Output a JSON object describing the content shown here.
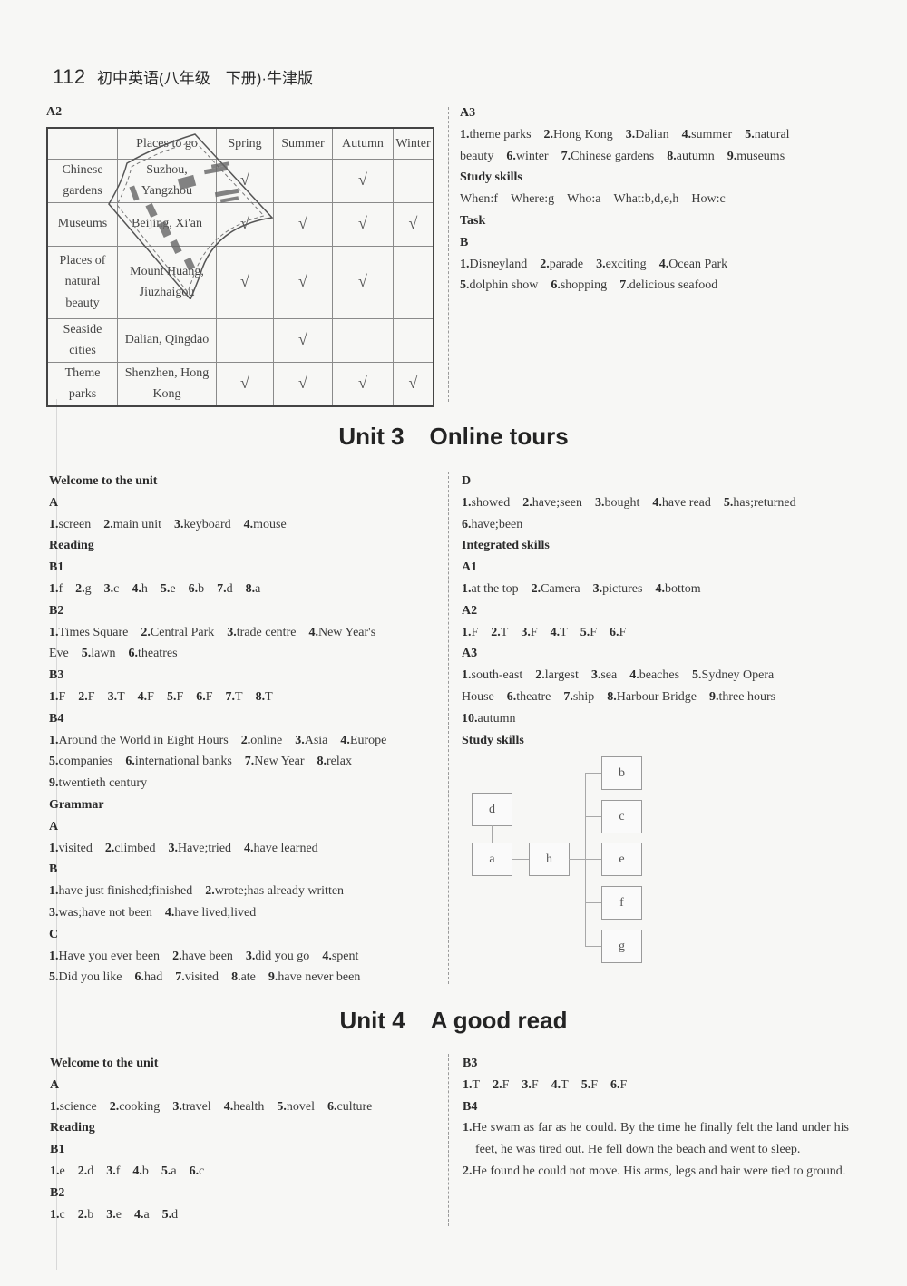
{
  "header": {
    "page_number": "112",
    "book_title": "初中英语(八年级　下册)·牛津版"
  },
  "unit2_tail": {
    "a2": {
      "label": "A2",
      "columns": [
        "",
        "Places to go",
        "Spring",
        "Summer",
        "Autumn",
        "Winter"
      ],
      "rows": [
        {
          "category": "Chinese gardens",
          "places": "Suzhou, Yangzhou",
          "spring": "√",
          "summer": "",
          "autumn": "√",
          "winter": ""
        },
        {
          "category": "Museums",
          "places": "Beijing, Xi'an",
          "spring": "√",
          "summer": "√",
          "autumn": "√",
          "winter": "√"
        },
        {
          "category": "Places of natural beauty",
          "places": "Mount Huang, Jiuzhaigou",
          "spring": "√",
          "summer": "√",
          "autumn": "√",
          "winter": ""
        },
        {
          "category": "Seaside cities",
          "places": "Dalian, Qingdao",
          "spring": "",
          "summer": "√",
          "autumn": "",
          "winter": ""
        },
        {
          "category": "Theme parks",
          "places": "Shenzhen, Hong Kong",
          "spring": "√",
          "summer": "√",
          "autumn": "√",
          "winter": "√"
        }
      ],
      "stamp_icon": "watermark-stamp"
    },
    "a3": {
      "label": "A3",
      "line1": [
        [
          "1.",
          "theme parks"
        ],
        [
          "2.",
          "Hong Kong"
        ],
        [
          "3.",
          "Dalian"
        ],
        [
          "4.",
          "summer"
        ],
        [
          "5.",
          "natural"
        ]
      ],
      "line2": [
        [
          "",
          "beauty"
        ],
        [
          "6.",
          "winter"
        ],
        [
          "7.",
          "Chinese gardens"
        ],
        [
          "8.",
          "autumn"
        ],
        [
          "9.",
          "museums"
        ]
      ]
    },
    "study_skills": {
      "label": "Study skills",
      "text": "When:f　Where:g　Who:a　What:b,d,e,h　How:c"
    },
    "task": {
      "label": "Task",
      "b_label": "B",
      "line1": [
        [
          "1.",
          "Disneyland"
        ],
        [
          "2.",
          "parade"
        ],
        [
          "3.",
          "exciting"
        ],
        [
          "4.",
          "Ocean Park"
        ]
      ],
      "line2": [
        [
          "5.",
          "dolphin show"
        ],
        [
          "6.",
          "shopping"
        ],
        [
          "7.",
          "delicious seafood"
        ]
      ]
    }
  },
  "unit3": {
    "number": "Unit 3",
    "name": "Online tours",
    "welcome": {
      "label": "Welcome to the unit",
      "a_label": "A",
      "answers": [
        [
          "1.",
          "screen"
        ],
        [
          "2.",
          "main unit"
        ],
        [
          "3.",
          "keyboard"
        ],
        [
          "4.",
          "mouse"
        ]
      ]
    },
    "reading": {
      "label": "Reading",
      "b1": {
        "label": "B1",
        "answers": [
          [
            "1.",
            "f"
          ],
          [
            "2.",
            "g"
          ],
          [
            "3.",
            "c"
          ],
          [
            "4.",
            "h"
          ],
          [
            "5.",
            "e"
          ],
          [
            "6.",
            "b"
          ],
          [
            "7.",
            "d"
          ],
          [
            "8.",
            "a"
          ]
        ]
      },
      "b2": {
        "label": "B2",
        "line1": [
          [
            "1.",
            "Times Square"
          ],
          [
            "2.",
            "Central Park"
          ],
          [
            "3.",
            "trade centre"
          ],
          [
            "4.",
            "New Year's"
          ]
        ],
        "line2": [
          [
            "",
            "Eve"
          ],
          [
            "5.",
            "lawn"
          ],
          [
            "6.",
            "theatres"
          ]
        ]
      },
      "b3": {
        "label": "B3",
        "answers": [
          [
            "1.",
            "F"
          ],
          [
            "2.",
            "F"
          ],
          [
            "3.",
            "T"
          ],
          [
            "4.",
            "F"
          ],
          [
            "5.",
            "F"
          ],
          [
            "6.",
            "F"
          ],
          [
            "7.",
            "T"
          ],
          [
            "8.",
            "T"
          ]
        ]
      },
      "b4": {
        "label": "B4",
        "line1": [
          [
            "1.",
            "Around the World in Eight Hours"
          ],
          [
            "2.",
            "online"
          ],
          [
            "3.",
            "Asia"
          ],
          [
            "4.",
            "Europe"
          ]
        ],
        "line2": [
          [
            "5.",
            "companies"
          ],
          [
            "6.",
            "international banks"
          ],
          [
            "7.",
            "New Year"
          ],
          [
            "8.",
            "relax"
          ]
        ],
        "line3": [
          [
            "9.",
            "twentieth century"
          ]
        ]
      }
    },
    "grammar": {
      "label": "Grammar",
      "a": {
        "label": "A",
        "answers": [
          [
            "1.",
            "visited"
          ],
          [
            "2.",
            "climbed"
          ],
          [
            "3.",
            "Have;tried"
          ],
          [
            "4.",
            "have learned"
          ]
        ]
      },
      "b": {
        "label": "B",
        "line1": [
          [
            "1.",
            "have just finished;finished"
          ],
          [
            "2.",
            "wrote;has already written"
          ]
        ],
        "line2": [
          [
            "3.",
            "was;have not been"
          ],
          [
            "4.",
            "have lived;lived"
          ]
        ]
      },
      "c": {
        "label": "C",
        "line1": [
          [
            "1.",
            "Have you ever been"
          ],
          [
            "2.",
            "have been"
          ],
          [
            "3.",
            "did you go"
          ],
          [
            "4.",
            "spent"
          ]
        ],
        "line2": [
          [
            "5.",
            "Did you like"
          ],
          [
            "6.",
            "had"
          ],
          [
            "7.",
            "visited"
          ],
          [
            "8.",
            "ate"
          ],
          [
            "9.",
            "have never been"
          ]
        ]
      },
      "d": {
        "label": "D",
        "line1": [
          [
            "1.",
            "showed"
          ],
          [
            "2.",
            "have;seen"
          ],
          [
            "3.",
            "bought"
          ],
          [
            "4.",
            "have read"
          ],
          [
            "5.",
            "has;returned"
          ]
        ],
        "line2": [
          [
            "6.",
            "have;been"
          ]
        ]
      }
    },
    "integrated": {
      "label": "Integrated skills",
      "a1": {
        "label": "A1",
        "answers": [
          [
            "1.",
            "at the top"
          ],
          [
            "2.",
            "Camera"
          ],
          [
            "3.",
            "pictures"
          ],
          [
            "4.",
            "bottom"
          ]
        ]
      },
      "a2": {
        "label": "A2",
        "answers": [
          [
            "1.",
            "F"
          ],
          [
            "2.",
            "T"
          ],
          [
            "3.",
            "F"
          ],
          [
            "4.",
            "T"
          ],
          [
            "5.",
            "F"
          ],
          [
            "6.",
            "F"
          ]
        ]
      },
      "a3": {
        "label": "A3",
        "line1": [
          [
            "1.",
            "south-east"
          ],
          [
            "2.",
            "largest"
          ],
          [
            "3.",
            "sea"
          ],
          [
            "4.",
            "beaches"
          ],
          [
            "5.",
            "Sydney Opera"
          ]
        ],
        "line2": [
          [
            "",
            "House"
          ],
          [
            "6.",
            "theatre"
          ],
          [
            "7.",
            "ship"
          ],
          [
            "8.",
            "Harbour Bridge"
          ],
          [
            "9.",
            "three hours"
          ]
        ],
        "line3": [
          [
            "10.",
            "autumn"
          ]
        ]
      }
    },
    "study_skills": {
      "label": "Study skills",
      "diagram": {
        "top": "d",
        "root": "a",
        "middle": "h",
        "branches": [
          "b",
          "c",
          "e",
          "f",
          "g"
        ]
      }
    }
  },
  "unit4": {
    "number": "Unit 4",
    "name": "A good read",
    "welcome": {
      "label": "Welcome to the unit",
      "a_label": "A",
      "answers": [
        [
          "1.",
          "science"
        ],
        [
          "2.",
          "cooking"
        ],
        [
          "3.",
          "travel"
        ],
        [
          "4.",
          "health"
        ],
        [
          "5.",
          "novel"
        ],
        [
          "6.",
          "culture"
        ]
      ]
    },
    "reading": {
      "label": "Reading",
      "b1": {
        "label": "B1",
        "answers": [
          [
            "1.",
            "e"
          ],
          [
            "2.",
            "d"
          ],
          [
            "3.",
            "f"
          ],
          [
            "4.",
            "b"
          ],
          [
            "5.",
            "a"
          ],
          [
            "6.",
            "c"
          ]
        ]
      },
      "b2": {
        "label": "B2",
        "answers": [
          [
            "1.",
            "c"
          ],
          [
            "2.",
            "b"
          ],
          [
            "3.",
            "e"
          ],
          [
            "4.",
            "a"
          ],
          [
            "5.",
            "d"
          ]
        ]
      },
      "b3": {
        "label": "B3",
        "answers": [
          [
            "1.",
            "T"
          ],
          [
            "2.",
            "F"
          ],
          [
            "3.",
            "F"
          ],
          [
            "4.",
            "T"
          ],
          [
            "5.",
            "F"
          ],
          [
            "6.",
            "F"
          ]
        ]
      },
      "b4": {
        "label": "B4",
        "items": [
          [
            "1.",
            "He swam as far as he could. By the time he finally felt the land under his feet, he was tired out. He fell down the beach and went to sleep."
          ],
          [
            "2.",
            "He found he could not move. His arms, legs and hair were tied to ground."
          ]
        ]
      }
    }
  }
}
